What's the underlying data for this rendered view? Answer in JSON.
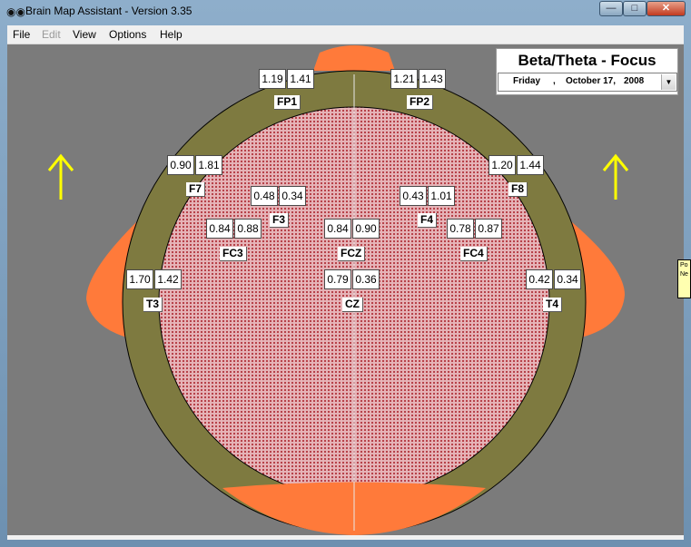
{
  "window": {
    "title": "Brain Map Assistant - Version 3.35",
    "controls": {
      "minimize": "—",
      "maximize": "□",
      "close": "✕"
    }
  },
  "menu": [
    "File",
    "Edit",
    "View",
    "Options",
    "Help"
  ],
  "header": {
    "title": "Beta/Theta - Focus",
    "date": {
      "day": "Friday",
      "sep": ",",
      "month_day": "October  17,",
      "year": "2008"
    }
  },
  "sites": [
    {
      "name": "FP1",
      "v1": "1.19",
      "v2": "1.41"
    },
    {
      "name": "FP2",
      "v1": "1.21",
      "v2": "1.43"
    },
    {
      "name": "F7",
      "v1": "0.90",
      "v2": "1.81"
    },
    {
      "name": "F8",
      "v1": "1.20",
      "v2": "1.44"
    },
    {
      "name": "F3",
      "v1": "0.48",
      "v2": "0.34"
    },
    {
      "name": "F4",
      "v1": "0.43",
      "v2": "1.01"
    },
    {
      "name": "FC3",
      "v1": "0.84",
      "v2": "0.88"
    },
    {
      "name": "FCZ",
      "v1": "0.84",
      "v2": "0.90"
    },
    {
      "name": "FC4",
      "v1": "0.78",
      "v2": "0.87"
    },
    {
      "name": "T3",
      "v1": "1.70",
      "v2": "1.42"
    },
    {
      "name": "CZ",
      "v1": "0.79",
      "v2": "0.36"
    },
    {
      "name": "T4",
      "v1": "0.42",
      "v2": "0.34"
    }
  ],
  "side_note": "Po Ne",
  "colors": {
    "outer_ring": "#7e7a40",
    "brain": "#d99aa0",
    "ears_nose": "#ff7a3a",
    "arrow": "#ffff00",
    "background": "#7b7b7b"
  },
  "icons": {
    "arrow_left": "arrow-up-icon",
    "arrow_right": "arrow-up-icon"
  }
}
